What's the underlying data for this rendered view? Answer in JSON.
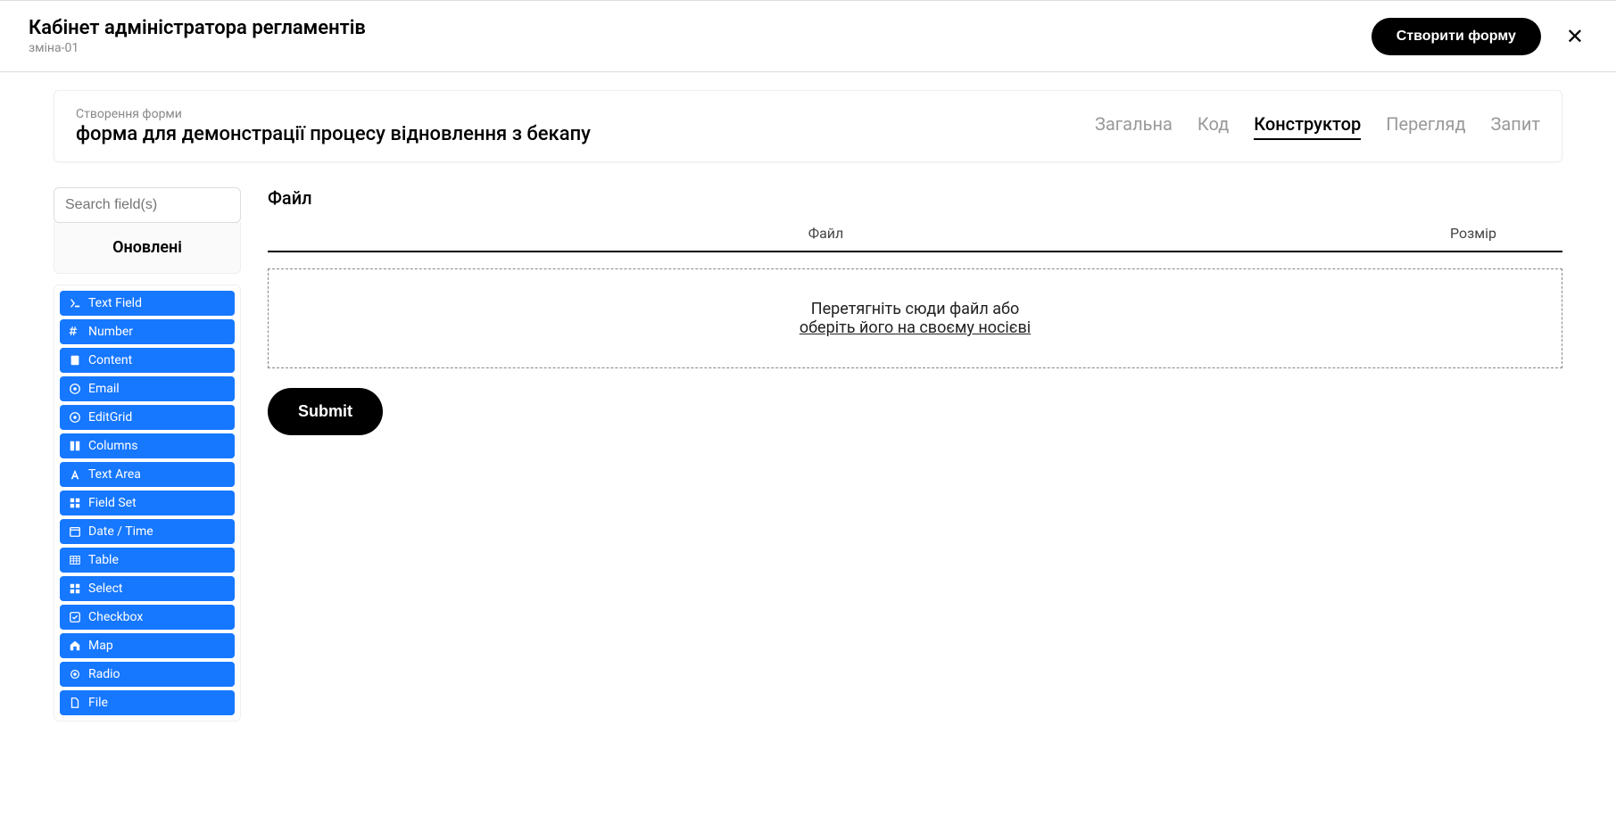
{
  "header": {
    "title": "Кабінет адміністратора регламентів",
    "subtitle": "зміна-01",
    "create_button": "Створити форму"
  },
  "subheader": {
    "breadcrumb": "Створення форми",
    "title": "форма для демонстрації процесу відновлення з бекапу"
  },
  "tabs": {
    "general": "Загальна",
    "code": "Код",
    "builder": "Конструктор",
    "preview": "Перегляд",
    "request": "Запит"
  },
  "sidebar": {
    "search_placeholder": "Search field(s)",
    "category": "Оновлені",
    "components": [
      {
        "icon": "terminal",
        "label": "Text Field"
      },
      {
        "icon": "hash",
        "label": "Number"
      },
      {
        "icon": "doc",
        "label": "Content"
      },
      {
        "icon": "at",
        "label": "Email"
      },
      {
        "icon": "at",
        "label": "EditGrid"
      },
      {
        "icon": "columns",
        "label": "Columns"
      },
      {
        "icon": "font",
        "label": "Text Area"
      },
      {
        "icon": "grid",
        "label": "Field Set"
      },
      {
        "icon": "calendar",
        "label": "Date / Time"
      },
      {
        "icon": "table",
        "label": "Table"
      },
      {
        "icon": "grid",
        "label": "Select"
      },
      {
        "icon": "check",
        "label": "Checkbox"
      },
      {
        "icon": "home",
        "label": "Map"
      },
      {
        "icon": "radio",
        "label": "Radio"
      },
      {
        "icon": "file",
        "label": "File"
      }
    ]
  },
  "canvas": {
    "section_label": "Файл",
    "col_file": "Файл",
    "col_size": "Розмір",
    "drop_text": "Перетягніть сюди файл або",
    "browse_text": "оберіть його на своєму носієві",
    "submit": "Submit"
  }
}
